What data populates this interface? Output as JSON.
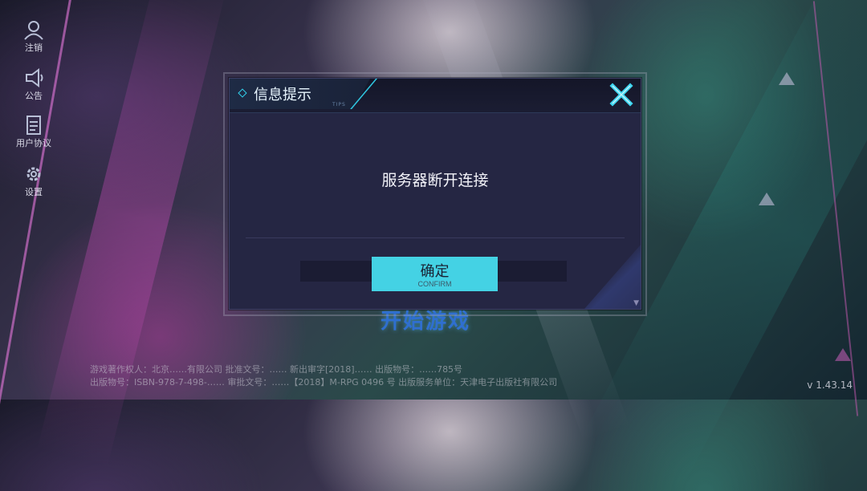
{
  "sidebar": {
    "items": [
      {
        "label": "注销",
        "icon": "logout-icon"
      },
      {
        "label": "公告",
        "icon": "megaphone-icon"
      },
      {
        "label": "用户协议",
        "icon": "document-icon"
      },
      {
        "label": "设置",
        "icon": "gear-icon"
      }
    ]
  },
  "main": {
    "start_label": "开始游戏",
    "version": "v 1.43.14",
    "footer_line1": "游戏著作权人：北京……有限公司   批准文号：…… 新出审字[2018]……  出版物号：……785号",
    "footer_line2": "出版物号：ISBN-978-7-498-……  审批文号：……【2018】M-RPG 0496 号   出版服务单位：天津电子出版社有限公司"
  },
  "dialog": {
    "title": "信息提示",
    "subtitle": "TIPS",
    "message": "服务器断开连接",
    "confirm_label": "确定",
    "confirm_sublabel": "CONFIRM",
    "close_icon": "close-x-icon"
  },
  "colors": {
    "accent": "#44d2e4",
    "dialog_bg": "#252643",
    "header_bg": "#141628",
    "start_text": "#2f6fd0"
  }
}
